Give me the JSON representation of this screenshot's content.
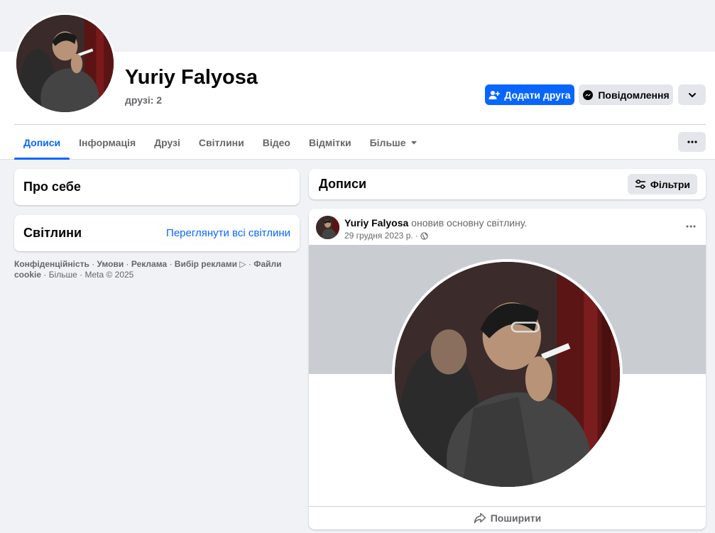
{
  "profile": {
    "name": "Yuriy Falyosa",
    "friends_label": "друзі: 2"
  },
  "actions": {
    "add_friend": "Додати друга",
    "message": "Повідомлення"
  },
  "tabs": [
    {
      "label": "Дописи",
      "active": true
    },
    {
      "label": "Інформація",
      "active": false
    },
    {
      "label": "Друзі",
      "active": false
    },
    {
      "label": "Світлини",
      "active": false
    },
    {
      "label": "Відео",
      "active": false
    },
    {
      "label": "Відмітки",
      "active": false
    },
    {
      "label": "Більше",
      "active": false
    }
  ],
  "sidebar": {
    "about_title": "Про себе",
    "photos_title": "Світлини",
    "photos_link": "Переглянути всі світлини"
  },
  "footer": {
    "privacy": "Конфіденційність",
    "terms": "Умови",
    "ads": "Реклама",
    "ad_choices": "Вибір реклами",
    "cookies": "Файли cookie",
    "more": "Більше",
    "copyright": "Meta © 2025"
  },
  "posts": {
    "header_title": "Дописи",
    "filters_label": "Фільтри"
  },
  "post": {
    "author": "Yuriy Falyosa",
    "action_text": "оновив основну світлину.",
    "date": "29 грудня 2023 р.",
    "share_label": "Поширити"
  },
  "colors": {
    "accent": "#0866ff",
    "background": "#f0f2f5",
    "secondary_button": "#e4e6eb",
    "muted_text": "#65676b"
  },
  "icons": {
    "add_friend": "person-plus-icon",
    "message": "messenger-icon",
    "dropdown": "chevron-down-icon",
    "more": "ellipsis-icon",
    "filters": "sliders-icon",
    "audience": "globe-icon",
    "share": "share-arrow-icon"
  }
}
